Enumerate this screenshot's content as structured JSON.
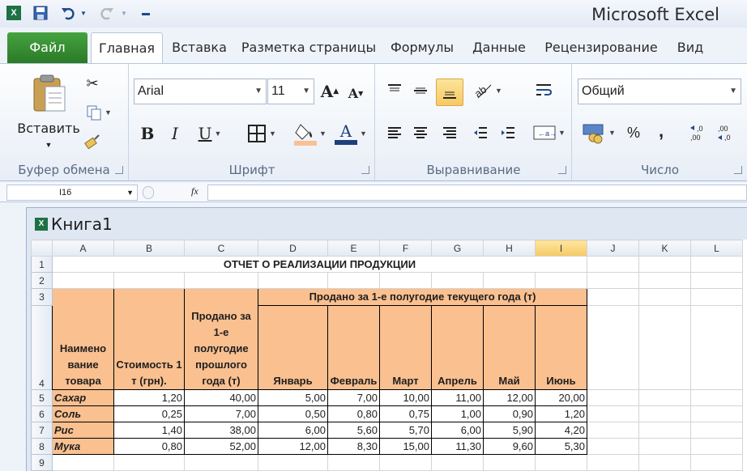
{
  "app": {
    "title": "Microsoft Excel"
  },
  "tabs": [
    "Файл",
    "Главная",
    "Вставка",
    "Разметка страницы",
    "Формулы",
    "Данные",
    "Рецензирование",
    "Вид"
  ],
  "ribbon": {
    "clipboard": {
      "label": "Буфер обмена",
      "paste": "Вставить"
    },
    "font": {
      "label": "Шрифт",
      "name": "Arial",
      "size": "11",
      "bold": "B",
      "italic": "I",
      "underline": "U",
      "font_color_letter": "A"
    },
    "alignment": {
      "label": "Выравнивание"
    },
    "number": {
      "label": "Число",
      "format": "Общий",
      "percent": "%",
      "comma": ","
    }
  },
  "formula_bar": {
    "name_box": "I16",
    "fx": "fx",
    "value": ""
  },
  "workbook": {
    "title": "Книга1"
  },
  "sheet": {
    "columns": [
      "A",
      "B",
      "C",
      "D",
      "E",
      "F",
      "G",
      "H",
      "I",
      "J",
      "K",
      "L"
    ],
    "selected_column": "I",
    "row_numbers": [
      "1",
      "2",
      "3",
      "4",
      "5",
      "6",
      "7",
      "8",
      "9"
    ],
    "title": "ОТЧЕТ О РЕАЛИЗАЦИИ ПРОДУКЦИИ",
    "group_header": "Продано за 1-е полугодие текущего года (т)",
    "headers": {
      "name": "Наимено вание товара",
      "cost": "Стоимость 1 т (грн).",
      "last_year": "Продано за 1-е полугодие прошлого года (т)",
      "months": [
        "Январь",
        "Февраль",
        "Март",
        "Апрель",
        "Май",
        "Июнь"
      ]
    },
    "rows": [
      {
        "name": "Сахар",
        "cost": "1,20",
        "last": "40,00",
        "months": [
          "5,00",
          "7,00",
          "10,00",
          "11,00",
          "12,00",
          "20,00"
        ]
      },
      {
        "name": "Соль",
        "cost": "0,25",
        "last": "7,00",
        "months": [
          "0,50",
          "0,80",
          "0,75",
          "1,00",
          "0,90",
          "1,20"
        ]
      },
      {
        "name": "Рис",
        "cost": "1,40",
        "last": "38,00",
        "months": [
          "6,00",
          "5,60",
          "5,70",
          "6,00",
          "5,90",
          "4,20"
        ]
      },
      {
        "name": "Мука",
        "cost": "0,80",
        "last": "52,00",
        "months": [
          "12,00",
          "8,30",
          "15,00",
          "11,30",
          "9,60",
          "5,30"
        ]
      }
    ]
  }
}
